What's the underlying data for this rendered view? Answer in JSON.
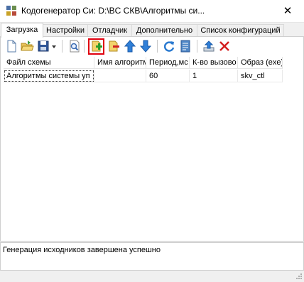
{
  "window": {
    "title": "Кодогенератор Си: D:\\BC СКВ\\Алгоритмы си...",
    "close_glyph": "✕",
    "app_icon": "app-grid-icon"
  },
  "tabs": [
    {
      "label": "Загрузка",
      "active": true
    },
    {
      "label": "Настройки",
      "active": false
    },
    {
      "label": "Отладчик",
      "active": false
    },
    {
      "label": "Дополнительно",
      "active": false
    },
    {
      "label": "Список конфигураций",
      "active": false
    }
  ],
  "toolbar": {
    "icons": [
      "new-file-icon",
      "open-folder-icon",
      "save-icon",
      "save-dropdown-icon",
      "preview-icon",
      "add-scheme-icon",
      "remove-scheme-icon",
      "move-up-icon",
      "move-down-icon",
      "refresh-icon",
      "report-icon",
      "export-icon",
      "delete-icon"
    ],
    "highlight_color": "#e0000f"
  },
  "table": {
    "columns": [
      "Файл схемы",
      "Имя алгоритм",
      "Период,мс",
      "К-во вызово",
      "Образ (exe)"
    ],
    "rows": [
      [
        "Алгоритмы системы уп",
        "",
        "60",
        "1",
        "skv_ctl"
      ]
    ]
  },
  "status": {
    "message": "Генерация исходников завершена успешно"
  }
}
